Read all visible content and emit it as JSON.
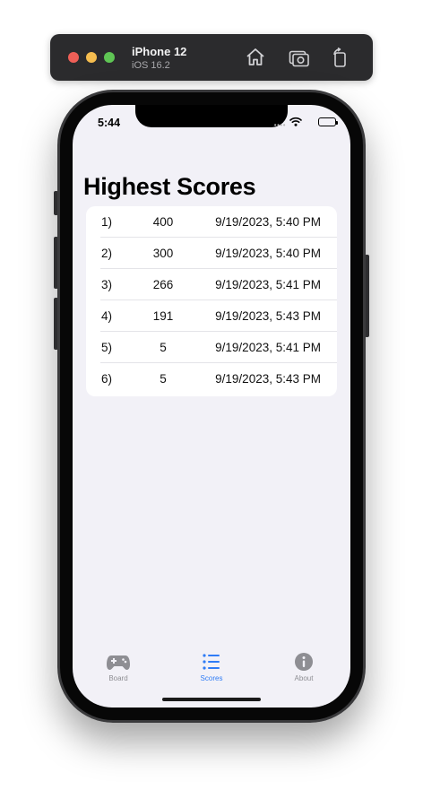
{
  "simulator": {
    "device_name": "iPhone 12",
    "os_version": "iOS 16.2",
    "buttons": [
      "home-icon",
      "screenshot-icon",
      "rotate-icon"
    ]
  },
  "status_bar": {
    "time": "5:44"
  },
  "page": {
    "title": "Highest Scores"
  },
  "scores": [
    {
      "rank": "1)",
      "score": "400",
      "date": "9/19/2023, 5:40 PM"
    },
    {
      "rank": "2)",
      "score": "300",
      "date": "9/19/2023, 5:40 PM"
    },
    {
      "rank": "3)",
      "score": "266",
      "date": "9/19/2023, 5:41 PM"
    },
    {
      "rank": "4)",
      "score": "191",
      "date": "9/19/2023, 5:43 PM"
    },
    {
      "rank": "5)",
      "score": "5",
      "date": "9/19/2023, 5:41 PM"
    },
    {
      "rank": "6)",
      "score": "5",
      "date": "9/19/2023, 5:43 PM"
    }
  ],
  "tab_bar": {
    "tabs": [
      {
        "label": "Board",
        "icon": "gamecontroller-icon",
        "active": false
      },
      {
        "label": "Scores",
        "icon": "list-icon",
        "active": true
      },
      {
        "label": "About",
        "icon": "info-icon",
        "active": false
      }
    ]
  },
  "colors": {
    "accent": "#2f7cf6",
    "inactive_tab": "#8e8e93",
    "screen_background": "#f2f1f7"
  }
}
